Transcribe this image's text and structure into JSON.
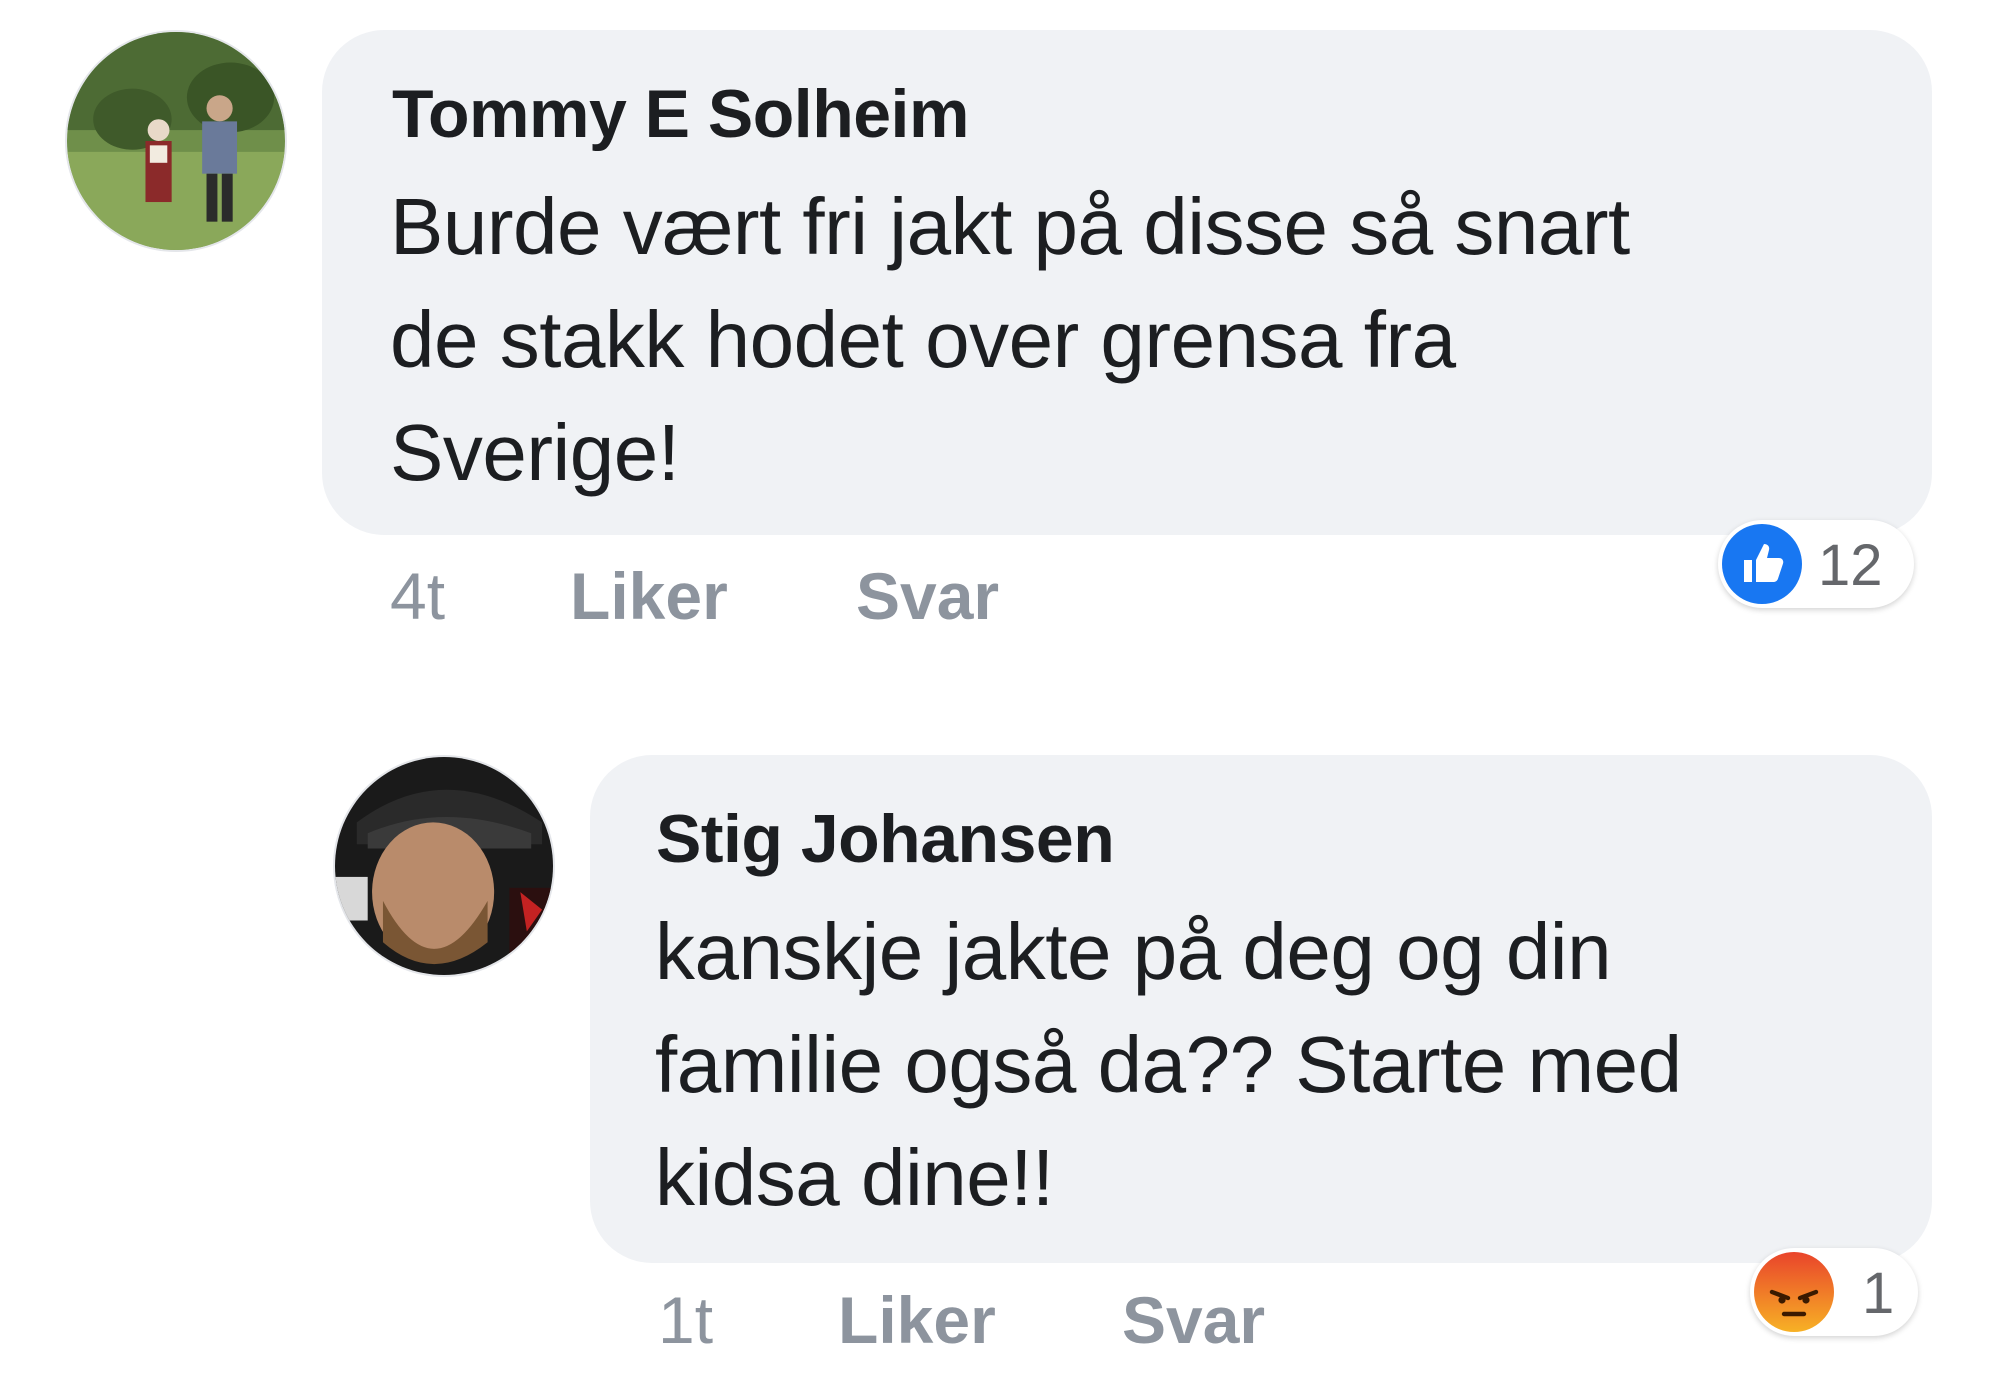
{
  "comments": [
    {
      "author": "Tommy E Solheim",
      "text_lines": [
        "Burde vært fri jakt på disse så snart",
        "de stakk hodet over grensa fra",
        "Sverige!"
      ],
      "timestamp": "4t",
      "like_label": "Liker",
      "reply_label": "Svar",
      "reaction": {
        "icon": "like-icon",
        "count": "12",
        "color": "#1877f2"
      }
    },
    {
      "author": "Stig Johansen",
      "text_lines": [
        "kanskje jakte på deg og din",
        "familie også da?? Starte med",
        "kidsa dine!!"
      ],
      "timestamp": "1t",
      "like_label": "Liker",
      "reply_label": "Svar",
      "reaction": {
        "icon": "angry-icon",
        "count": "1",
        "color": "#e9710f"
      }
    }
  ]
}
